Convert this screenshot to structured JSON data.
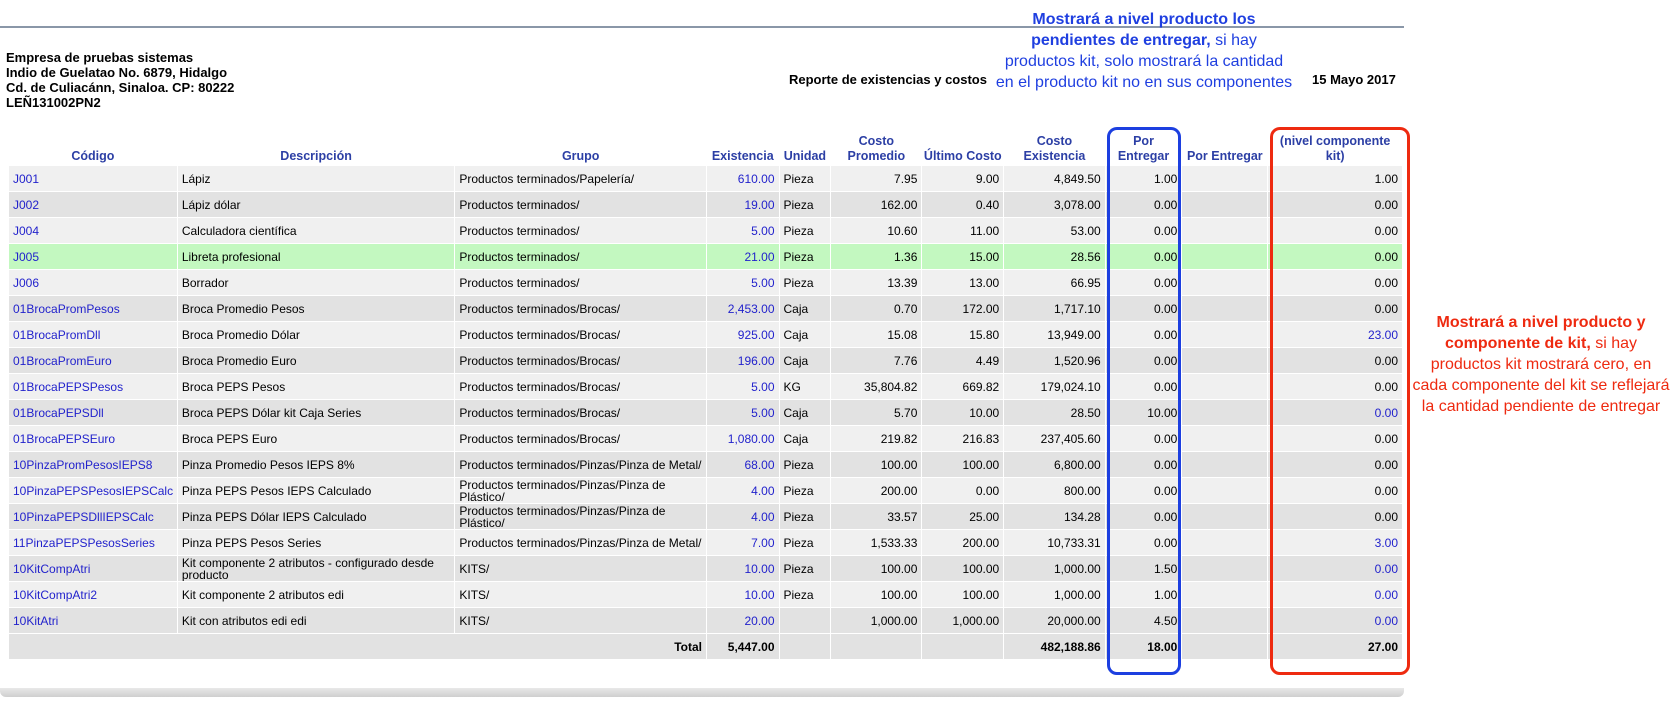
{
  "company": {
    "name": "Empresa de pruebas sistemas",
    "address1": "Indio de Guelatao No. 6879, Hidalgo",
    "address2": "Cd. de Culiacánn, Sinaloa. CP: 80222",
    "rfc": "LEÑ131002PN2"
  },
  "report": {
    "title": "Reporte de existencias y costos",
    "date": "15 Mayo 2017"
  },
  "annotations": {
    "blue_bold": "Mostrará a nivel producto los pendientes de entregar,",
    "blue_rest": " si hay productos kit, solo mostrará la cantidad en el producto kit no en sus componentes",
    "red_bold": "Mostrará a nivel producto y componente de kit,",
    "red_rest": " si hay productos kit mostrará cero, en cada componente del kit se reflejará la cantidad pendiente de entregar"
  },
  "headers": {
    "codigo": "Código",
    "descripcion": "Descripción",
    "grupo": "Grupo",
    "existencia": "Existencia",
    "unidad": "Unidad",
    "costo_promedio": "Costo Promedio",
    "ultimo_costo": "Último Costo",
    "costo_existencia": "Costo Existencia",
    "por_entregar": "Por Entregar",
    "por_entregar2": "Por Entregar",
    "nivel_componente": "(nivel componente kit)"
  },
  "rows": [
    {
      "codigo": "J001",
      "descripcion": "Lápiz",
      "grupo": "Productos terminados/Papelería/",
      "existencia": "610.00",
      "unidad": "Pieza",
      "costo_promedio": "7.95",
      "ultimo_costo": "9.00",
      "costo_existencia": "4,849.50",
      "por_entregar": "1.00",
      "por_entregar2": "",
      "nivel": "1.00",
      "nivel_blue": false
    },
    {
      "codigo": "J002",
      "descripcion": "Lápiz dólar",
      "grupo": "Productos terminados/",
      "existencia": "19.00",
      "unidad": "Pieza",
      "costo_promedio": "162.00",
      "ultimo_costo": "0.40",
      "costo_existencia": "3,078.00",
      "por_entregar": "0.00",
      "por_entregar2": "",
      "nivel": "0.00",
      "nivel_blue": false
    },
    {
      "codigo": "J004",
      "descripcion": "Calculadora científica",
      "grupo": "Productos terminados/",
      "existencia": "5.00",
      "unidad": "Pieza",
      "costo_promedio": "10.60",
      "ultimo_costo": "11.00",
      "costo_existencia": "53.00",
      "por_entregar": "0.00",
      "por_entregar2": "",
      "nivel": "0.00",
      "nivel_blue": false
    },
    {
      "codigo": "J005",
      "descripcion": "Libreta profesional",
      "grupo": "Productos terminados/",
      "existencia": "21.00",
      "unidad": "Pieza",
      "costo_promedio": "1.36",
      "ultimo_costo": "15.00",
      "costo_existencia": "28.56",
      "por_entregar": "0.00",
      "por_entregar2": "",
      "nivel": "0.00",
      "nivel_blue": false
    },
    {
      "codigo": "J006",
      "descripcion": "Borrador",
      "grupo": "Productos terminados/",
      "existencia": "5.00",
      "unidad": "Pieza",
      "costo_promedio": "13.39",
      "ultimo_costo": "13.00",
      "costo_existencia": "66.95",
      "por_entregar": "0.00",
      "por_entregar2": "",
      "nivel": "0.00",
      "nivel_blue": false
    },
    {
      "codigo": "01BrocaPromPesos",
      "descripcion": "Broca Promedio Pesos",
      "grupo": "Productos terminados/Brocas/",
      "existencia": "2,453.00",
      "unidad": "Caja",
      "costo_promedio": "0.70",
      "ultimo_costo": "172.00",
      "costo_existencia": "1,717.10",
      "por_entregar": "0.00",
      "por_entregar2": "",
      "nivel": "0.00",
      "nivel_blue": false
    },
    {
      "codigo": "01BrocaPromDll",
      "descripcion": "Broca Promedio Dólar",
      "grupo": "Productos terminados/Brocas/",
      "existencia": "925.00",
      "unidad": "Caja",
      "costo_promedio": "15.08",
      "ultimo_costo": "15.80",
      "costo_existencia": "13,949.00",
      "por_entregar": "0.00",
      "por_entregar2": "",
      "nivel": "23.00",
      "nivel_blue": true
    },
    {
      "codigo": "01BrocaPromEuro",
      "descripcion": "Broca Promedio Euro",
      "grupo": "Productos terminados/Brocas/",
      "existencia": "196.00",
      "unidad": "Caja",
      "costo_promedio": "7.76",
      "ultimo_costo": "4.49",
      "costo_existencia": "1,520.96",
      "por_entregar": "0.00",
      "por_entregar2": "",
      "nivel": "0.00",
      "nivel_blue": false
    },
    {
      "codigo": "01BrocaPEPSPesos",
      "descripcion": "Broca PEPS Pesos",
      "grupo": "Productos terminados/Brocas/",
      "existencia": "5.00",
      "unidad": "KG",
      "costo_promedio": "35,804.82",
      "ultimo_costo": "669.82",
      "costo_existencia": "179,024.10",
      "por_entregar": "0.00",
      "por_entregar2": "",
      "nivel": "0.00",
      "nivel_blue": false
    },
    {
      "codigo": "01BrocaPEPSDll",
      "descripcion": "Broca PEPS Dólar kit Caja Series",
      "grupo": "Productos terminados/Brocas/",
      "existencia": "5.00",
      "unidad": "Caja",
      "costo_promedio": "5.70",
      "ultimo_costo": "10.00",
      "costo_existencia": "28.50",
      "por_entregar": "10.00",
      "por_entregar2": "",
      "nivel": "0.00",
      "nivel_blue": true
    },
    {
      "codigo": "01BrocaPEPSEuro",
      "descripcion": "Broca PEPS Euro",
      "grupo": "Productos terminados/Brocas/",
      "existencia": "1,080.00",
      "unidad": "Caja",
      "costo_promedio": "219.82",
      "ultimo_costo": "216.83",
      "costo_existencia": "237,405.60",
      "por_entregar": "0.00",
      "por_entregar2": "",
      "nivel": "0.00",
      "nivel_blue": false
    },
    {
      "codigo": "10PinzaPromPesosIEPS8",
      "descripcion": "Pinza Promedio Pesos IEPS 8%",
      "grupo": "Productos terminados/Pinzas/Pinza de Metal/",
      "existencia": "68.00",
      "unidad": "Pieza",
      "costo_promedio": "100.00",
      "ultimo_costo": "100.00",
      "costo_existencia": "6,800.00",
      "por_entregar": "0.00",
      "por_entregar2": "",
      "nivel": "0.00",
      "nivel_blue": false
    },
    {
      "codigo": "10PinzaPEPSPesosIEPSCalc",
      "descripcion": "Pinza PEPS Pesos IEPS Calculado",
      "grupo": "Productos terminados/Pinzas/Pinza de Plástico/",
      "existencia": "4.00",
      "unidad": "Pieza",
      "costo_promedio": "200.00",
      "ultimo_costo": "0.00",
      "costo_existencia": "800.00",
      "por_entregar": "0.00",
      "por_entregar2": "",
      "nivel": "0.00",
      "nivel_blue": false
    },
    {
      "codigo": "10PinzaPEPSDllIEPSCalc",
      "descripcion": "Pinza PEPS Dólar IEPS Calculado",
      "grupo": "Productos terminados/Pinzas/Pinza de Plástico/",
      "existencia": "4.00",
      "unidad": "Pieza",
      "costo_promedio": "33.57",
      "ultimo_costo": "25.00",
      "costo_existencia": "134.28",
      "por_entregar": "0.00",
      "por_entregar2": "",
      "nivel": "0.00",
      "nivel_blue": false
    },
    {
      "codigo": "11PinzaPEPSPesosSeries",
      "descripcion": "Pinza PEPS Pesos Series",
      "grupo": "Productos terminados/Pinzas/Pinza de Metal/",
      "existencia": "7.00",
      "unidad": "Pieza",
      "costo_promedio": "1,533.33",
      "ultimo_costo": "200.00",
      "costo_existencia": "10,733.31",
      "por_entregar": "0.00",
      "por_entregar2": "",
      "nivel": "3.00",
      "nivel_blue": true
    },
    {
      "codigo": "10KitCompAtri",
      "descripcion": "Kit componente 2 atributos - configurado desde producto",
      "grupo": "KITS/",
      "existencia": "10.00",
      "unidad": "Pieza",
      "costo_promedio": "100.00",
      "ultimo_costo": "100.00",
      "costo_existencia": "1,000.00",
      "por_entregar": "1.50",
      "por_entregar2": "",
      "nivel": "0.00",
      "nivel_blue": true
    },
    {
      "codigo": "10KitCompAtri2",
      "descripcion": "Kit componente 2 atributos edi",
      "grupo": "KITS/",
      "existencia": "10.00",
      "unidad": "Pieza",
      "costo_promedio": "100.00",
      "ultimo_costo": "100.00",
      "costo_existencia": "1,000.00",
      "por_entregar": "1.00",
      "por_entregar2": "",
      "nivel": "0.00",
      "nivel_blue": true
    },
    {
      "codigo": "10KitAtri",
      "descripcion": "Kit con atributos edi edi",
      "grupo": "KITS/",
      "existencia": "20.00",
      "unidad": "",
      "costo_promedio": "1,000.00",
      "ultimo_costo": "1,000.00",
      "costo_existencia": "20,000.00",
      "por_entregar": "4.50",
      "por_entregar2": "",
      "nivel": "0.00",
      "nivel_blue": true
    }
  ],
  "total": {
    "label": "Total",
    "existencia": "5,447.00",
    "costo_existencia": "482,188.86",
    "por_entregar": "18.00",
    "nivel": "27.00"
  },
  "colors": {
    "link": "#2222cc",
    "header": "#2c3fa5",
    "highlight_row": "#c3f8c0",
    "blue_annotation": "#1f3fe0",
    "red_annotation": "#ee2a10"
  }
}
